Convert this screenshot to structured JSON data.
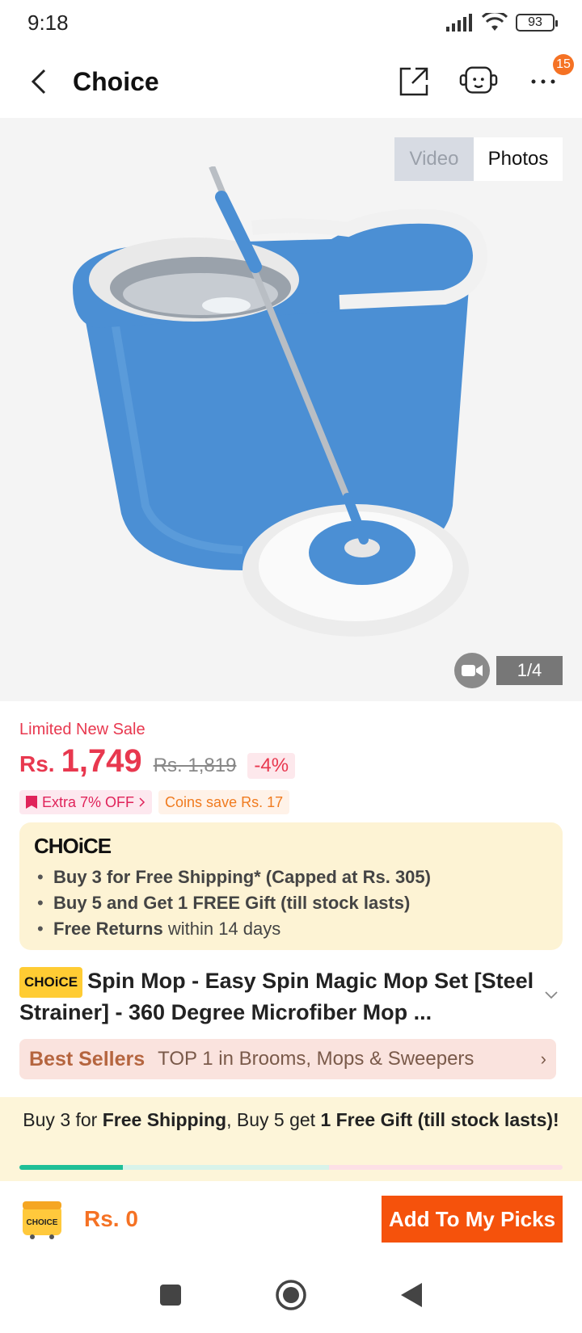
{
  "status_bar": {
    "time": "9:18",
    "battery": "93"
  },
  "nav": {
    "title": "Choice",
    "badge_count": "15"
  },
  "gallery": {
    "tab_video": "Video",
    "tab_photos": "Photos",
    "page_indicator": "1/4"
  },
  "pricing": {
    "sale_label": "Limited New Sale",
    "currency": "Rs.",
    "price": "1,749",
    "original_price": "Rs. 1,819",
    "discount": "-4%",
    "promo_extra": "Extra 7% OFF",
    "promo_coins": "Coins save Rs. 17"
  },
  "choice_box": {
    "logo": "CHOiCE",
    "item1": "Buy 3 for  Free Shipping* (Capped at Rs. 305)",
    "item2": "Buy 5 and Get 1 FREE Gift (till stock lasts)",
    "item3_bold": "Free Returns",
    "item3_rest": " within 14 days"
  },
  "product": {
    "chip": "CHOiCE",
    "title": "Spin Mop - Easy Spin Magic Mop Set [Steel Strainer] - 360 Degree Microfiber Mop ..."
  },
  "bestseller": {
    "label": "Best Sellers",
    "text": "TOP 1 in Brooms, Mops & Sweepers"
  },
  "shipping_banner": {
    "part1": "Buy 3 for ",
    "part2": "Free Shipping",
    "part3": ", Buy 5 get ",
    "part4": "1 Free Gift (till stock lasts)!",
    "progress": 0.19,
    "progress_secondary": 0.57
  },
  "bottom_bar": {
    "cart_logo": "CHOICE",
    "total": "Rs. 0",
    "add_button": "Add To My Picks"
  },
  "colors": {
    "accent": "#f57224",
    "price": "#e8384f",
    "progress": "#1fbf97"
  }
}
